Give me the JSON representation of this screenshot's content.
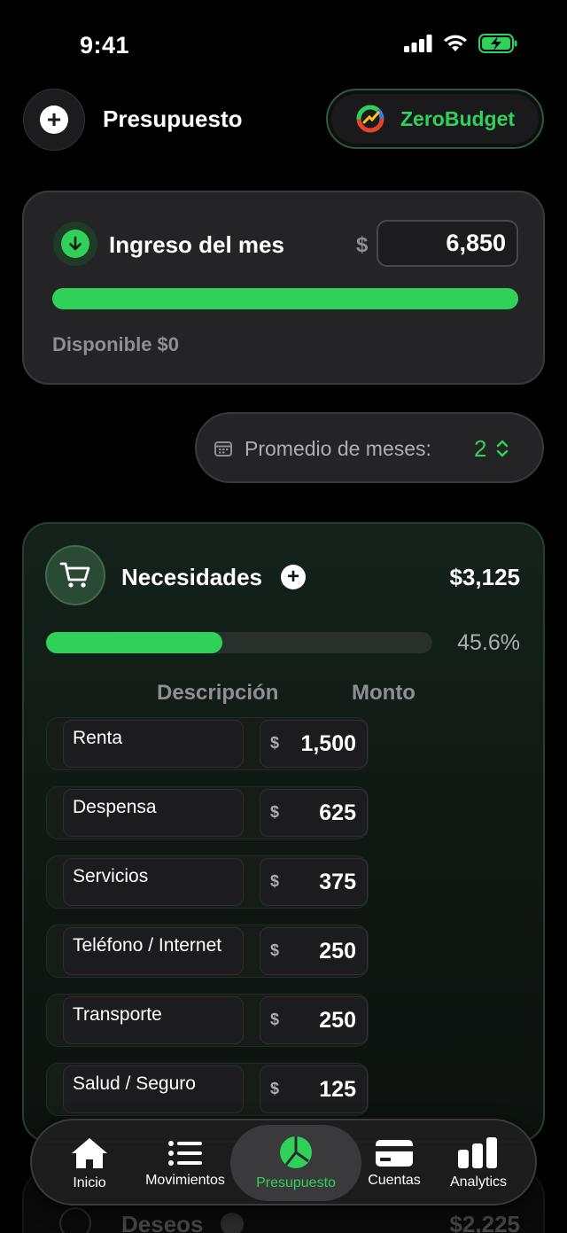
{
  "status_bar": {
    "time": "9:41"
  },
  "header": {
    "title": "Presupuesto",
    "brand_label": "ZeroBudget"
  },
  "income": {
    "title": "Ingreso del mes",
    "currency": "$",
    "amount": "6,850",
    "progress_fraction": 1.0,
    "available": "Disponible $0"
  },
  "average": {
    "label": "Promedio de meses:",
    "value": "2"
  },
  "needs": {
    "title": "Necesidades",
    "total": "$3,125",
    "percent": "45.6%",
    "progress_fraction": 0.456,
    "col_description": "Descripción",
    "col_amount": "Monto",
    "items": [
      {
        "description": "Renta",
        "currency": "$",
        "amount": "1,500"
      },
      {
        "description": "Despensa",
        "currency": "$",
        "amount": "625"
      },
      {
        "description": "Servicios",
        "currency": "$",
        "amount": "375"
      },
      {
        "description": "Teléfono / Internet",
        "currency": "$",
        "amount": "250"
      },
      {
        "description": "Transporte",
        "currency": "$",
        "amount": "250"
      },
      {
        "description": "Salud / Seguro",
        "currency": "$",
        "amount": "125"
      }
    ]
  },
  "wants": {
    "title": "Deseos",
    "total": "$2,225"
  },
  "tabs": [
    {
      "label": "Inicio",
      "icon": "home-icon"
    },
    {
      "label": "Movimientos",
      "icon": "list-icon"
    },
    {
      "label": "Presupuesto",
      "icon": "pie-chart-icon",
      "active": true
    },
    {
      "label": "Cuentas",
      "icon": "card-icon"
    },
    {
      "label": "Analytics",
      "icon": "bar-chart-icon"
    }
  ],
  "colors": {
    "accent": "#30d158",
    "background": "#000000",
    "card": "#242426"
  }
}
